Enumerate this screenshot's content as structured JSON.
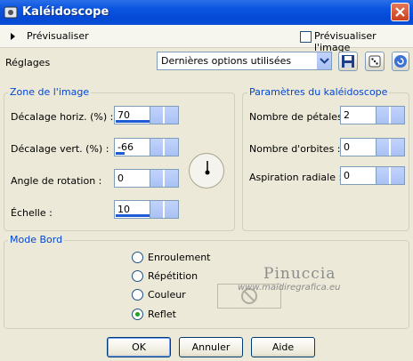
{
  "window": {
    "title": "Kaléidoscope"
  },
  "preview": {
    "toggle_label": "Prévisualiser",
    "checkbox_label": "Prévisualiser l'image"
  },
  "settings": {
    "label": "Réglages",
    "preset_value": "Dernières options utilisées"
  },
  "image_zone": {
    "legend": "Zone de l'image",
    "h_offset_label": "Décalage horiz. (%) :",
    "h_offset_value": "70",
    "v_offset_label": "Décalage vert. (%) :",
    "v_offset_value": "-66",
    "rotation_label": "Angle de rotation :",
    "rotation_value": "0",
    "scale_label": "Échelle :",
    "scale_value": "10"
  },
  "kaleido_params": {
    "legend": "Paramètres du kaléidoscope",
    "petals_label": "Nombre de pétales :",
    "petals_value": "2",
    "orbits_label": "Nombre d'orbites :",
    "orbits_value": "0",
    "radial_label": "Aspiration radiale :",
    "radial_value": "0"
  },
  "edge_mode": {
    "legend": "Mode Bord",
    "options": [
      "Enroulement",
      "Répétition",
      "Couleur",
      "Reflet"
    ],
    "selected": "Reflet"
  },
  "watermark": {
    "name": "Pinuccia",
    "url": "www.maidiregrafica.eu"
  },
  "buttons": {
    "ok": "OK",
    "cancel": "Annuler",
    "help": "Aide"
  }
}
